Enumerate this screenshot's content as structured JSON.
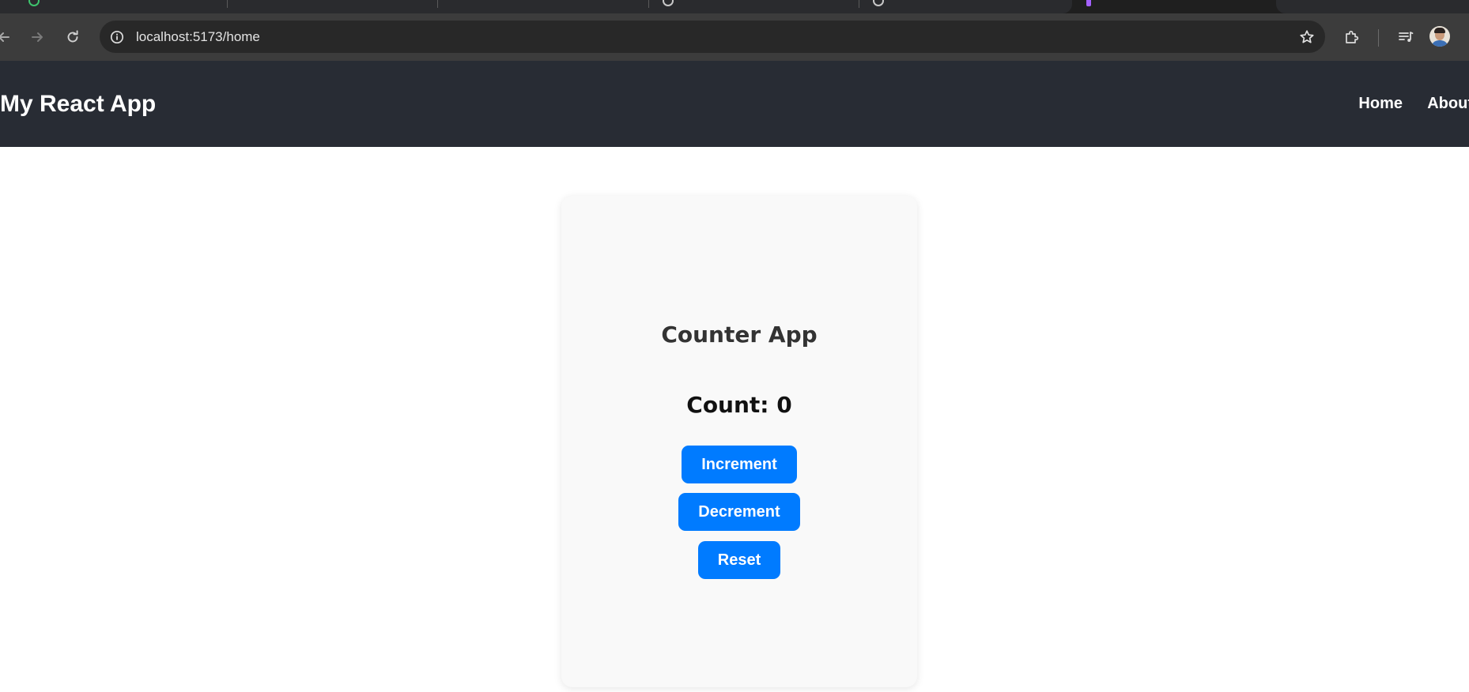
{
  "browser": {
    "url": "localhost:5173/home",
    "icons": {
      "back": "arrow-left-icon",
      "forward": "arrow-right-icon",
      "reload": "reload-icon",
      "site_info": "info-icon",
      "bookmark": "star-icon",
      "extensions": "puzzle-icon",
      "media": "media-queue-icon",
      "profile": "avatar"
    },
    "colors": {
      "tabstrip": "#1f1f1f",
      "toolbar": "#3c3c3c",
      "omnibox": "#282828"
    }
  },
  "app": {
    "header": {
      "title": "My React App",
      "background": "#282c34",
      "nav": [
        {
          "label": "Home"
        },
        {
          "label": "About"
        }
      ]
    },
    "card": {
      "heading": "Counter App",
      "count_text": "Count: 0",
      "buttons": [
        {
          "label": "Increment"
        },
        {
          "label": "Decrement"
        },
        {
          "label": "Reset"
        }
      ],
      "button_color": "#007bff",
      "background": "#f9f9f9"
    }
  }
}
